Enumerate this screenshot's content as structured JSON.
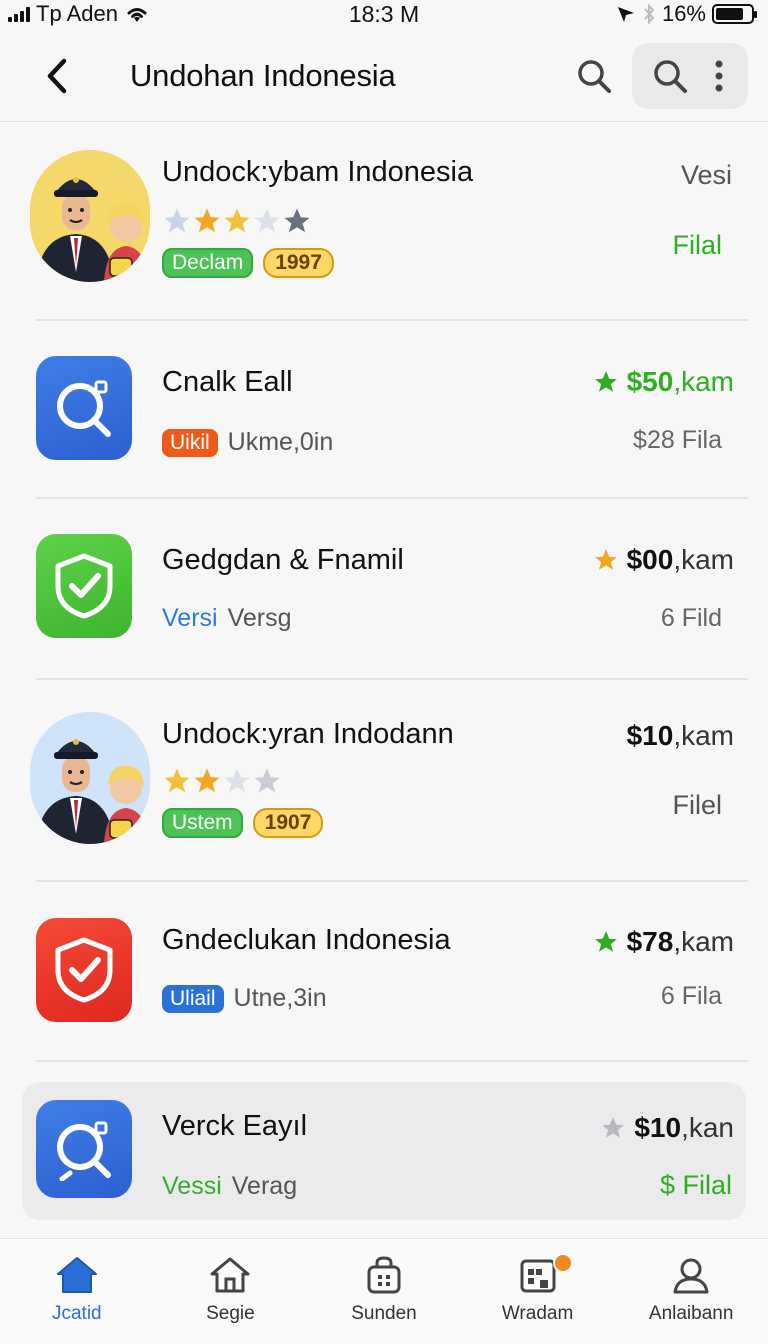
{
  "status": {
    "carrier": "Tp Aden",
    "time": "18:3 M",
    "battery": "16%",
    "battery_level": 0.8
  },
  "header": {
    "title": "Undohan Indonesia"
  },
  "colors": {
    "accent": "#2a6fd6",
    "green": "#2fae21",
    "orange_star": "#f5a623",
    "gray_star": "#b8b8bf"
  },
  "rows": [
    {
      "title": "Undock:ybam Indonesia",
      "right_top": "Vesi",
      "right_bottom": "Filal",
      "rating_icons": [
        "star-gray",
        "star-orange",
        "star-orange",
        "star-gray",
        "star-dark"
      ],
      "pill_green": "Declam",
      "pill_gold": "1997"
    },
    {
      "title": "Cnalk Eall",
      "price_amount": "$50",
      "price_unit": ",kam",
      "price_star": "green",
      "right_bottom": "$28 Fila",
      "tag": "Uikil",
      "meta": "Ukme,0in"
    },
    {
      "title": "Gedgdan & Fnamil",
      "price_amount": "$00",
      "price_unit": ",kam",
      "price_star": "orange",
      "right_bottom": "6 Fild",
      "link": "Versi",
      "meta": "Versg"
    },
    {
      "title": "Undock:yran Indodann",
      "price_amount": "$10",
      "price_unit": ",kam",
      "right_bottom": "Filel",
      "rating_icons": [
        "star-orange",
        "star-orange",
        "star-gray",
        "star-gray"
      ],
      "pill_green": "Ustem",
      "pill_gold": "1907"
    },
    {
      "title": "Gndeclukan Indonesia",
      "price_amount": "$78",
      "price_unit": ",kam",
      "price_star": "green",
      "right_bottom": "6 Fila",
      "tag": "Uliail",
      "meta": "Utne,3in"
    },
    {
      "title": "Verck Eayıl",
      "price_amount": "$10",
      "price_unit": ",kan",
      "price_star": "gray",
      "right_bottom": "$ Filal",
      "link": "Vessi",
      "meta": "Verag"
    }
  ],
  "tabs": [
    {
      "label": "Jcatid",
      "icon": "home-filled-icon"
    },
    {
      "label": "Segie",
      "icon": "home-outline-icon"
    },
    {
      "label": "Sunden",
      "icon": "bag-icon"
    },
    {
      "label": "Wradam",
      "icon": "calendar-icon"
    },
    {
      "label": "Anlaibann",
      "icon": "profile-icon"
    }
  ]
}
